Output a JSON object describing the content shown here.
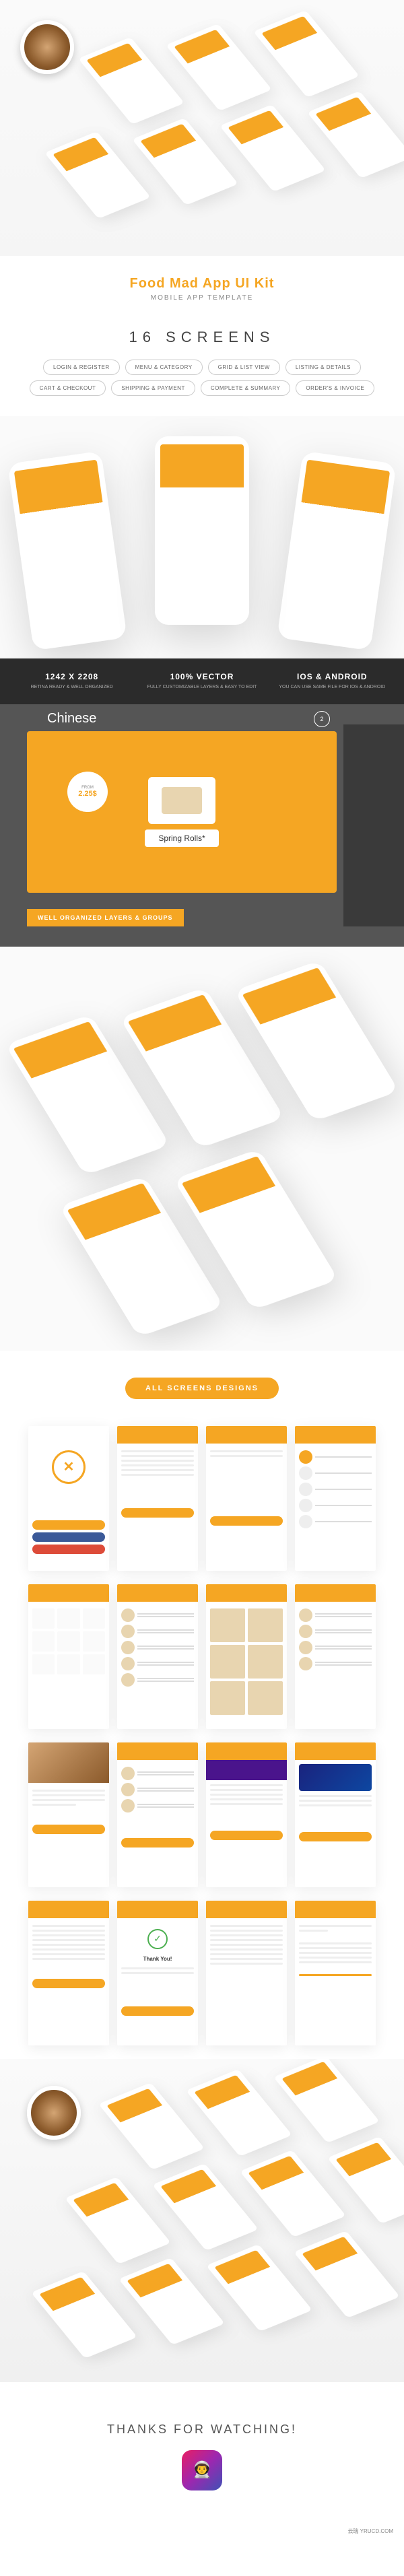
{
  "hero": {
    "title": "Food Mad App UI Kit",
    "subtitle": "MOBILE APP TEMPLATE"
  },
  "screens_header": "16 SCREENS",
  "feature_pills": [
    "LOGIN & REGISTER",
    "MENU & CATEGORY",
    "GRID & LIST VIEW",
    "LISTING & DETAILS",
    "CART & CHECKOUT",
    "SHIPPING & PAYMENT",
    "COMPLETE & SUMMARY",
    "ORDER'S & INVOICE"
  ],
  "dark_features": [
    {
      "big": "1242 X 2208",
      "small": "RETINA READY & WELL ORGANIZED"
    },
    {
      "big": "100% VECTOR",
      "small": "FULLY CUSTOMIZABLE LAYERS & EASY TO EDIT"
    },
    {
      "big": "IOS & ANDROID",
      "small": "YOU CAN USE SAME FILE FOR IOS & ANDROID"
    }
  ],
  "editor": {
    "category_header": "Chinese",
    "cart_count": "2",
    "price_label": "FROM",
    "price_value": "2.25$",
    "item_name": "Spring Rolls*",
    "badge": "WELL ORGANIZED LAYERS & GROUPS"
  },
  "section_all_screens": "ALL SCREENS DESIGNS",
  "mini_screens": {
    "thank_you_title": "Thank You!"
  },
  "thanks": {
    "text": "THANKS FOR WATCHING!",
    "icon_emoji": "👨‍🚀"
  },
  "watermark": "云瑞 YRUCD.COM",
  "colors": {
    "accent": "#f5a623",
    "dark": "#2b2b2b"
  }
}
